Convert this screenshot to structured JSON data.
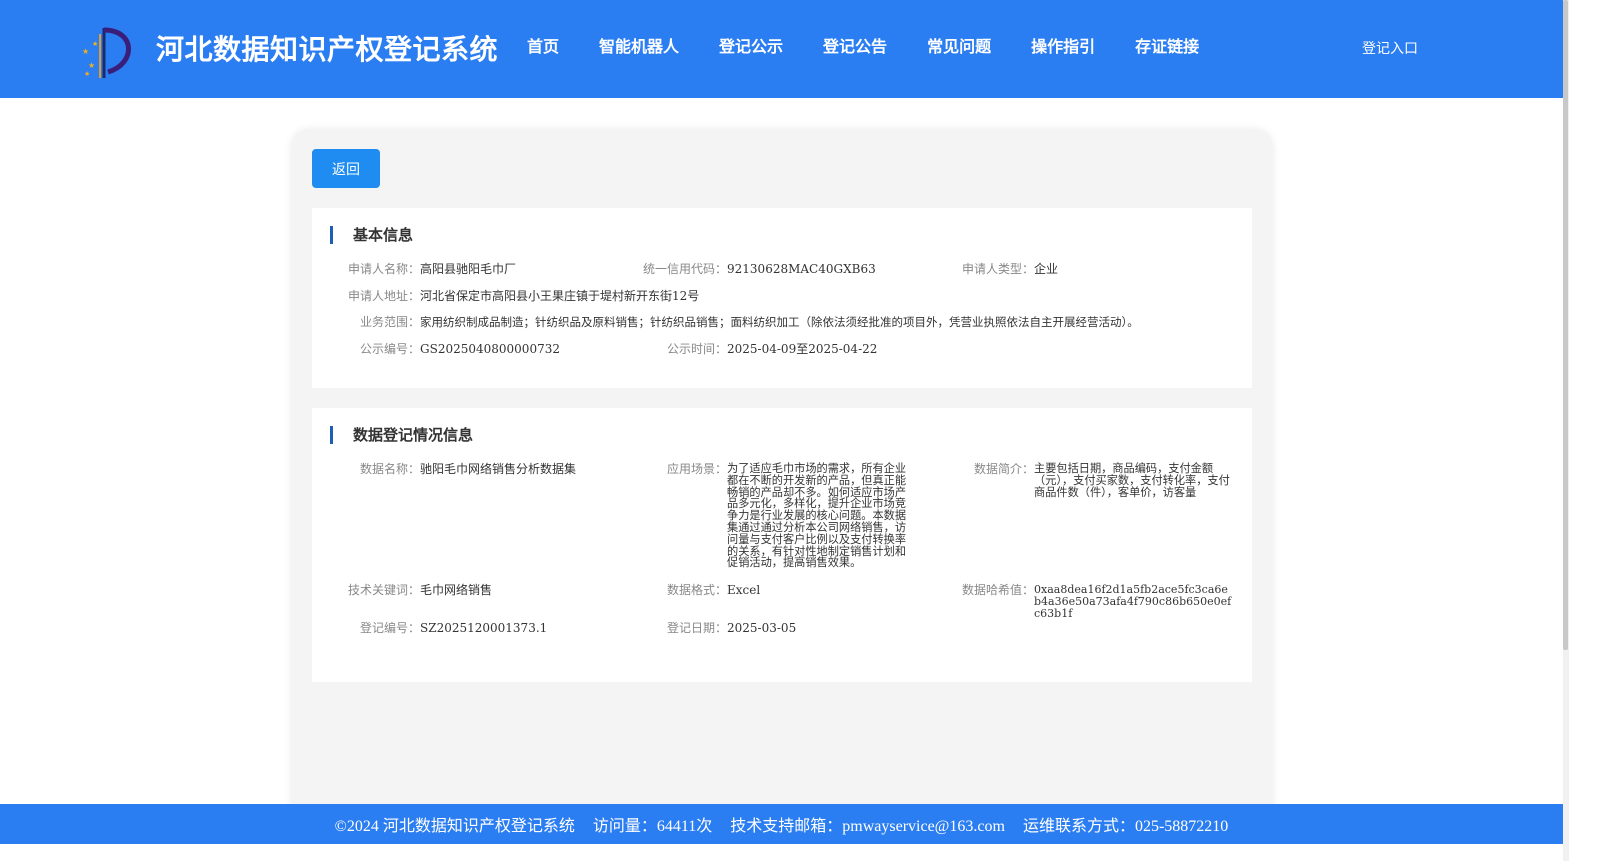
{
  "header": {
    "site_title": "河北数据知识产权登记系统",
    "nav": [
      "首页",
      "智能机器人",
      "登记公示",
      "登记公告",
      "常见问题",
      "操作指引",
      "存证链接"
    ],
    "login_label": "登记入口"
  },
  "back_label": "返回",
  "basic_info": {
    "title": "基本信息",
    "applicant_name_label": "申请人名称：",
    "applicant_name": "高阳县驰阳毛巾厂",
    "credit_code_label": "统一信用代码：",
    "credit_code": "92130628MAC40GXB63",
    "applicant_type_label": "申请人类型：",
    "applicant_type": "企业",
    "address_label": "申请人地址：",
    "address": "河北省保定市高阳县小王果庄镇于堤村新开东街12号",
    "scope_label": "业务范围：",
    "scope": "家用纺织制成品制造；针纺织品及原料销售；针纺织品销售；面料纺织加工（除依法须经批准的项目外，凭营业执照依法自主开展经营活动）。",
    "notice_no_label": "公示编号：",
    "notice_no": "GS2025040800000732",
    "notice_time_label": "公示时间：",
    "notice_time": "2025-04-09至2025-04-22"
  },
  "data_info": {
    "title": "数据登记情况信息",
    "data_name_label": "数据名称：",
    "data_name": "驰阳毛巾网络销售分析数据集",
    "scenario_label": "应用场景：",
    "scenario": "为了适应毛巾市场的需求，所有企业都在不断的开发新的产品，但真正能畅销的产品却不多。如何适应市场产品多元化，多样化，提升企业市场竞争力是行业发展的核心问题。本数据集通过通过分析本公司网络销售，访问量与支付客户比例以及支付转换率的关系，有针对性地制定销售计划和促销活动，提高销售效果。",
    "summary_label": "数据简介：",
    "summary": "主要包括日期，商品编码，支付金额（元），支付买家数，支付转化率，支付商品件数（件），客单价，访客量",
    "keywords_label": "技术关键词：",
    "keywords": "毛巾网络销售",
    "format_label": "数据格式：",
    "format": "Excel",
    "hash_label": "数据哈希值：",
    "hash": "0xaa8dea16f2d1a5fb2ace5fc3ca6eb4a36e50a73afa4f790c86b650e0efc63b1f",
    "reg_no_label": "登记编号：",
    "reg_no": "SZ2025120001373.1",
    "reg_date_label": "登记日期：",
    "reg_date": "2025-03-05"
  },
  "footer": {
    "copyright": "©2024 河北数据知识产权登记系统",
    "visits": "访问量：64411次",
    "email": "技术支持邮箱：pmwayservice@163.com",
    "phone": "运维联系方式：025-58872210"
  },
  "colors": {
    "header_bg": "#2b7df2",
    "button_bg": "#1e8cf0",
    "title_bar": "#1e5fb5"
  }
}
